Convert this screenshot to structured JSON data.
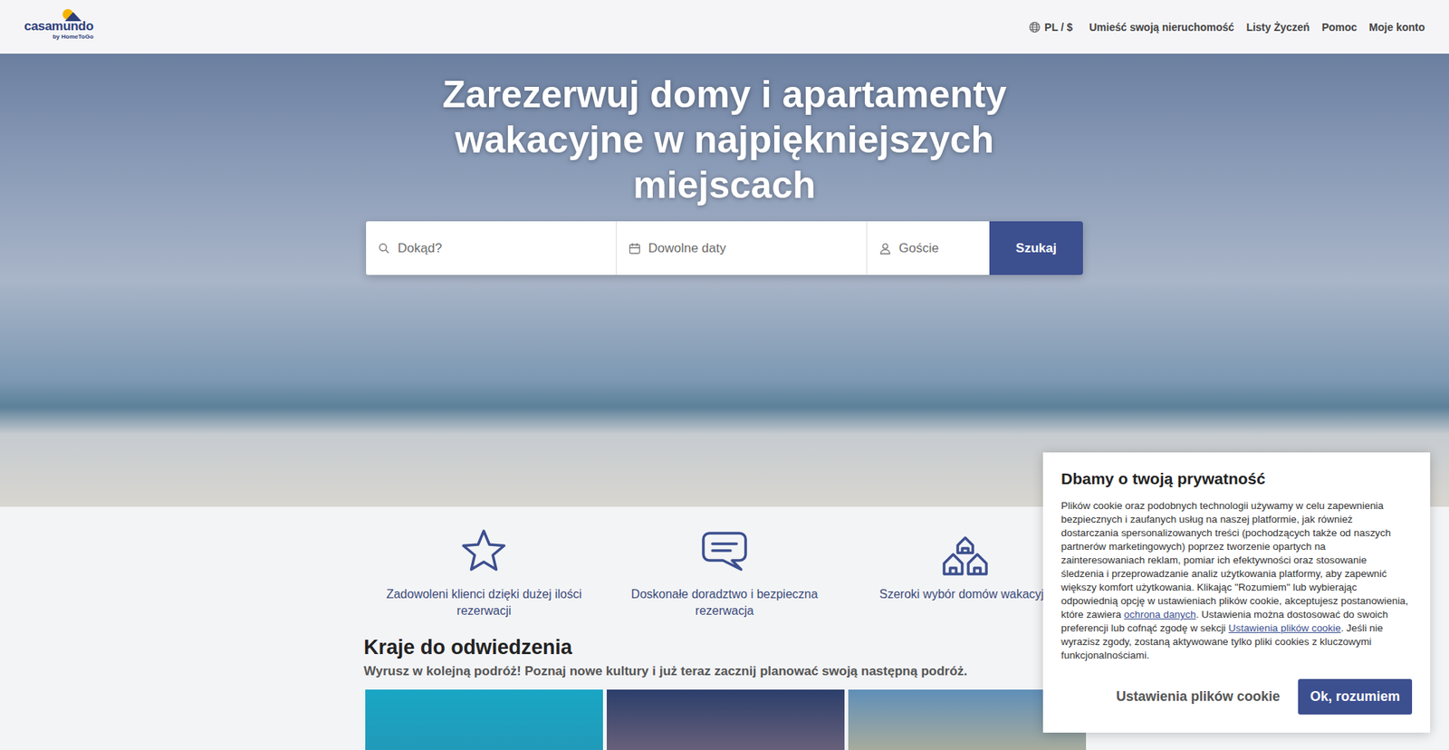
{
  "header": {
    "logo": {
      "name": "casamundo",
      "tagline": "by HomeToGo"
    },
    "locale": "PL / $",
    "nav": [
      "Umieść swoją nieruchomość",
      "Listy Życzeń",
      "Pomoc",
      "Moje konto"
    ]
  },
  "hero": {
    "title": "Zarezerwuj domy i apartamenty wakacyjne w najpiękniejszych miejscach",
    "search": {
      "destination_placeholder": "Dokąd?",
      "dates_placeholder": "Dowolne daty",
      "guests_placeholder": "Goście",
      "button": "Szukaj"
    }
  },
  "features": [
    {
      "text": "Zadowoleni klienci dzięki dużej ilości rezerwacji"
    },
    {
      "text": "Doskonałe doradztwo i bezpieczna rezerwacja"
    },
    {
      "text": "Szeroki wybór domów wakacyjn"
    }
  ],
  "countries": {
    "title": "Kraje do odwiedzenia",
    "subtitle": "Wyrusz w kolejną podróż! Poznaj nowe kultury i już teraz zacznij planować swoją następną podróż."
  },
  "cookie_banner": {
    "title": "Dbamy o twoją prywatność",
    "body": [
      {
        "kind": "text",
        "text": "Plików cookie oraz podobnych technologii używamy w celu zapewnienia bezpiecznych i zaufanych usług na naszej platformie, jak również dostarczania spersonalizowanych treści (pochodzących także od naszych partnerów marketingowych) poprzez tworzenie opartych na zainteresowaniach reklam, pomiar ich efektywności oraz stosowanie śledzenia i przeprowadzanie analiz użytkowania platformy, aby zapewnić większy komfort użytkowania. Klikając \"Rozumiem\" lub wybierając odpowiednią opcję w ustawieniach plików cookie, akceptujesz postanowienia, które zawiera "
      },
      {
        "kind": "link",
        "text": "ochrona danych"
      },
      {
        "kind": "text",
        "text": ". Ustawienia można dostosować do swoich preferencji lub cofnąć zgodę w sekcji "
      },
      {
        "kind": "link",
        "text": "Ustawienia plików cookie"
      },
      {
        "kind": "text",
        "text": ". Jeśli nie wyrazisz zgody, zostaną aktywowane tylko pliki cookies z kluczowymi funkcjonalnościami."
      }
    ],
    "settings_button": "Ustawienia plików cookie",
    "accept_button": "Ok, rozumiem"
  }
}
